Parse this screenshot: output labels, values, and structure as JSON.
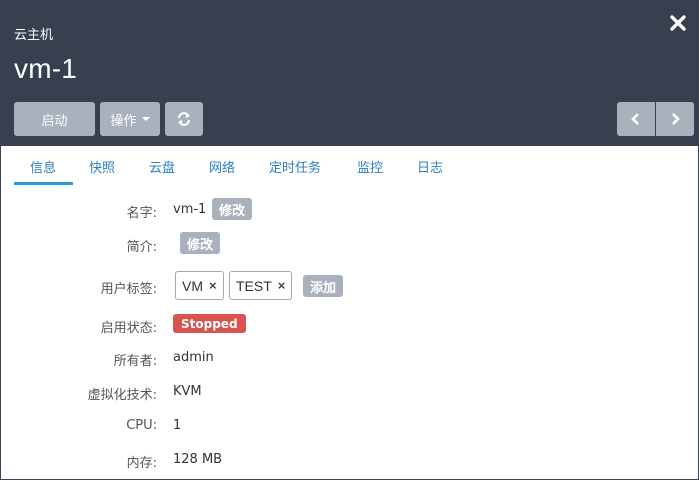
{
  "header": {
    "subtitle": "云主机",
    "title": "vm-1",
    "start_label": "启动",
    "ops_label": "操作"
  },
  "tabs": [
    {
      "label": "信息"
    },
    {
      "label": "快照"
    },
    {
      "label": "云盘"
    },
    {
      "label": "网络"
    },
    {
      "label": "定时任务"
    },
    {
      "label": "监控"
    },
    {
      "label": "日志"
    }
  ],
  "info": {
    "name_label": "名字:",
    "name_value": "vm-1",
    "edit_label": "修改",
    "desc_label": "简介:",
    "tags_label": "用户标签:",
    "tags": [
      "VM",
      "TEST"
    ],
    "tag_remove": "×",
    "add_label": "添加",
    "state_label": "启用状态:",
    "state_value": "Stopped",
    "owner_label": "所有者:",
    "owner_value": "admin",
    "virt_label": "虚拟化技术:",
    "virt_value": "KVM",
    "cpu_label": "CPU:",
    "cpu_value": "1",
    "mem_label": "内存:",
    "mem_value": "128 MB"
  },
  "colors": {
    "header_bg": "#36404f",
    "button_bg": "#a9b1bd",
    "tab_active": "#2b9ad8",
    "stopped_badge": "#d9534f"
  },
  "icons": [
    "close-icon",
    "caret-down-icon",
    "refresh-icon",
    "chevron-left-icon",
    "chevron-right-icon"
  ]
}
